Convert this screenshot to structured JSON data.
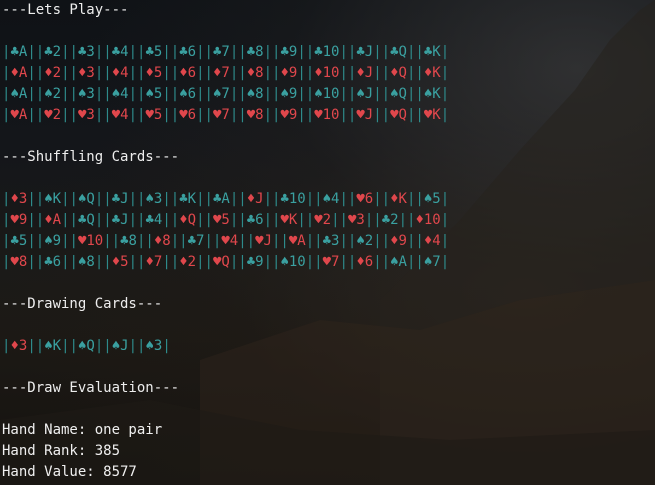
{
  "colors": {
    "black_suit": "#3aa0a0",
    "red_suit": "#e0474c",
    "bar": "#2e8b8b",
    "text": "#ededed"
  },
  "headings": {
    "lets_play": "---Lets Play---",
    "shuffling": "---Shuffling Cards---",
    "drawing": "---Drawing Cards---",
    "evaluation": "---Draw Evaluation---"
  },
  "deck_rows": [
    [
      [
        "♣",
        "A"
      ],
      [
        "♣",
        "2"
      ],
      [
        "♣",
        "3"
      ],
      [
        "♣",
        "4"
      ],
      [
        "♣",
        "5"
      ],
      [
        "♣",
        "6"
      ],
      [
        "♣",
        "7"
      ],
      [
        "♣",
        "8"
      ],
      [
        "♣",
        "9"
      ],
      [
        "♣",
        "10"
      ],
      [
        "♣",
        "J"
      ],
      [
        "♣",
        "Q"
      ],
      [
        "♣",
        "K"
      ]
    ],
    [
      [
        "♦",
        "A"
      ],
      [
        "♦",
        "2"
      ],
      [
        "♦",
        "3"
      ],
      [
        "♦",
        "4"
      ],
      [
        "♦",
        "5"
      ],
      [
        "♦",
        "6"
      ],
      [
        "♦",
        "7"
      ],
      [
        "♦",
        "8"
      ],
      [
        "♦",
        "9"
      ],
      [
        "♦",
        "10"
      ],
      [
        "♦",
        "J"
      ],
      [
        "♦",
        "Q"
      ],
      [
        "♦",
        "K"
      ]
    ],
    [
      [
        "♠",
        "A"
      ],
      [
        "♠",
        "2"
      ],
      [
        "♠",
        "3"
      ],
      [
        "♠",
        "4"
      ],
      [
        "♠",
        "5"
      ],
      [
        "♠",
        "6"
      ],
      [
        "♠",
        "7"
      ],
      [
        "♠",
        "8"
      ],
      [
        "♠",
        "9"
      ],
      [
        "♠",
        "10"
      ],
      [
        "♠",
        "J"
      ],
      [
        "♠",
        "Q"
      ],
      [
        "♠",
        "K"
      ]
    ],
    [
      [
        "♥",
        "A"
      ],
      [
        "♥",
        "2"
      ],
      [
        "♥",
        "3"
      ],
      [
        "♥",
        "4"
      ],
      [
        "♥",
        "5"
      ],
      [
        "♥",
        "6"
      ],
      [
        "♥",
        "7"
      ],
      [
        "♥",
        "8"
      ],
      [
        "♥",
        "9"
      ],
      [
        "♥",
        "10"
      ],
      [
        "♥",
        "J"
      ],
      [
        "♥",
        "Q"
      ],
      [
        "♥",
        "K"
      ]
    ]
  ],
  "shuffled_rows": [
    [
      [
        "♦",
        "3"
      ],
      [
        "♠",
        "K"
      ],
      [
        "♠",
        "Q"
      ],
      [
        "♣",
        "J"
      ],
      [
        "♠",
        "3"
      ],
      [
        "♣",
        "K"
      ],
      [
        "♣",
        "A"
      ],
      [
        "♦",
        "J"
      ],
      [
        "♣",
        "10"
      ],
      [
        "♠",
        "4"
      ],
      [
        "♥",
        "6"
      ],
      [
        "♦",
        "K"
      ],
      [
        "♠",
        "5"
      ]
    ],
    [
      [
        "♥",
        "9"
      ],
      [
        "♦",
        "A"
      ],
      [
        "♣",
        "Q"
      ],
      [
        "♣",
        "J"
      ],
      [
        "♣",
        "4"
      ],
      [
        "♦",
        "Q"
      ],
      [
        "♥",
        "5"
      ],
      [
        "♣",
        "6"
      ],
      [
        "♥",
        "K"
      ],
      [
        "♥",
        "2"
      ],
      [
        "♥",
        "3"
      ],
      [
        "♣",
        "2"
      ],
      [
        "♦",
        "10"
      ]
    ],
    [
      [
        "♣",
        "5"
      ],
      [
        "♠",
        "9"
      ],
      [
        "♥",
        "10"
      ],
      [
        "♣",
        "8"
      ],
      [
        "♦",
        "8"
      ],
      [
        "♣",
        "7"
      ],
      [
        "♥",
        "4"
      ],
      [
        "♥",
        "J"
      ],
      [
        "♥",
        "A"
      ],
      [
        "♣",
        "3"
      ],
      [
        "♠",
        "2"
      ],
      [
        "♦",
        "9"
      ],
      [
        "♦",
        "4"
      ]
    ],
    [
      [
        "♥",
        "8"
      ],
      [
        "♣",
        "6"
      ],
      [
        "♠",
        "8"
      ],
      [
        "♦",
        "5"
      ],
      [
        "♦",
        "7"
      ],
      [
        "♦",
        "2"
      ],
      [
        "♥",
        "Q"
      ],
      [
        "♣",
        "9"
      ],
      [
        "♠",
        "10"
      ],
      [
        "♥",
        "7"
      ],
      [
        "♦",
        "6"
      ],
      [
        "♠",
        "A"
      ],
      [
        "♠",
        "7"
      ]
    ]
  ],
  "drawn_row": [
    [
      "♦",
      "3"
    ],
    [
      "♠",
      "K"
    ],
    [
      "♠",
      "Q"
    ],
    [
      "♠",
      "J"
    ],
    [
      "♠",
      "3"
    ]
  ],
  "evaluation": {
    "hand_name": "Hand Name: one pair",
    "hand_rank": "Hand Rank: 385",
    "hand_value": "Hand Value: 8577"
  }
}
